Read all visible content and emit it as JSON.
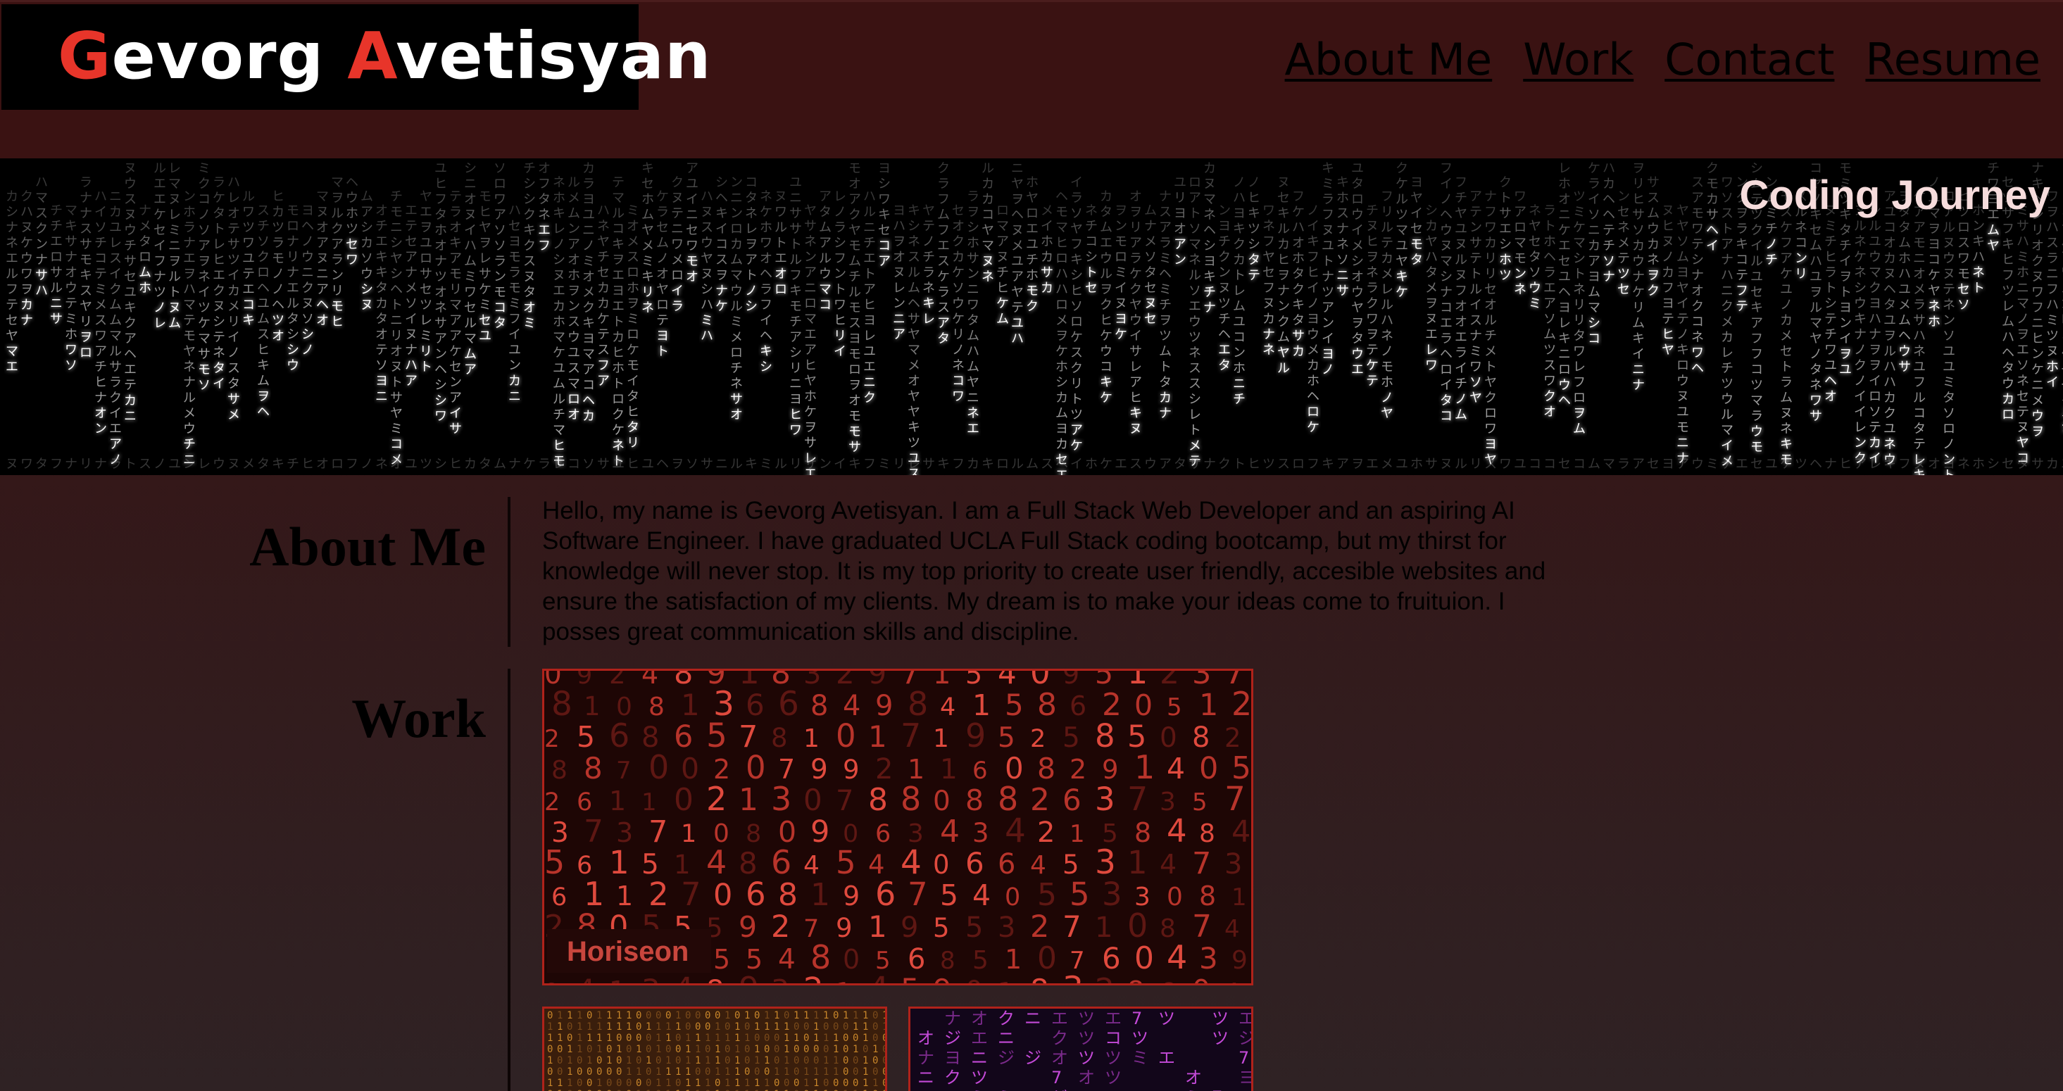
{
  "header": {
    "logo": {
      "first_initial": "G",
      "first_rest": "evorg ",
      "last_initial": "A",
      "last_rest": "vetisyan"
    },
    "nav": [
      {
        "label": "About Me"
      },
      {
        "label": "Work"
      },
      {
        "label": "Contact"
      },
      {
        "label": "Resume"
      }
    ]
  },
  "hero": {
    "title": "Coding Journey"
  },
  "about": {
    "heading": "About Me",
    "text": "Hello, my name is Gevorg Avetisyan. I am a Full Stack Web Developer and an aspiring AI Software Engineer. I have graduated UCLA Full Stack coding bootcamp, but my thirst for knowledge will never stop. It is my top priority to create user friendly, accesible websites and ensure the satisfaction of my clients. My dream is to make your ideas come to fruituion. I posses great communication skills and discipline."
  },
  "work": {
    "heading": "Work",
    "projects": [
      {
        "label": "Horiseon"
      }
    ]
  },
  "colors": {
    "accent": "#e8352a",
    "header_bg": "#3a1212",
    "card_border": "#b0221a",
    "card_label": "#c8463d"
  }
}
